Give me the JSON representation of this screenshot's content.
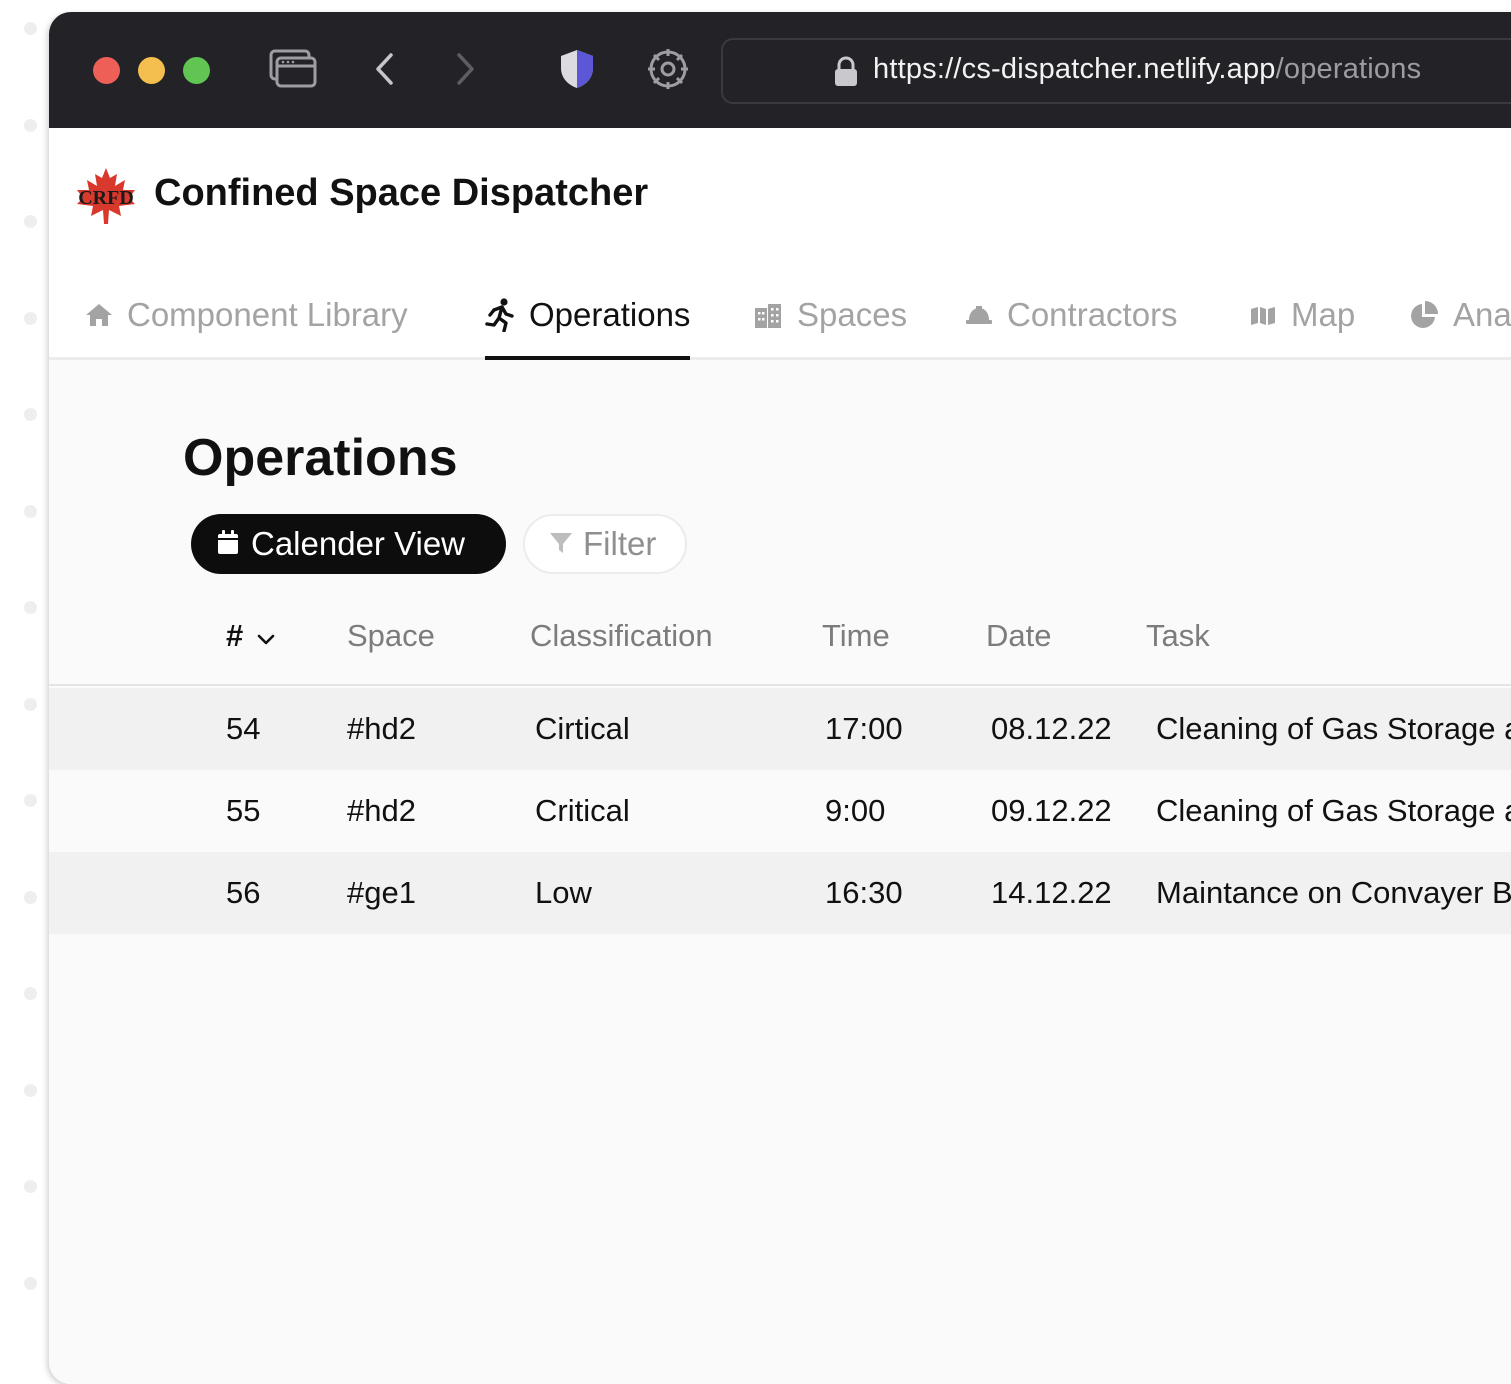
{
  "browser": {
    "url_host": "https://cs-dispatcher.netlify.app",
    "url_path": "/operations",
    "icons": [
      "tabs-icon",
      "back-icon",
      "forward-icon",
      "shield-icon",
      "settings-icon",
      "lock-icon"
    ]
  },
  "app": {
    "logo_text": "CRFD",
    "title": "Confined Space Dispatcher"
  },
  "nav": {
    "items": [
      {
        "label": "Component Library",
        "icon": "home-icon",
        "active": false
      },
      {
        "label": "Operations",
        "icon": "running-person-icon",
        "active": true
      },
      {
        "label": "Spaces",
        "icon": "buildings-icon",
        "active": false
      },
      {
        "label": "Contractors",
        "icon": "hard-hat-icon",
        "active": false
      },
      {
        "label": "Map",
        "icon": "map-icon",
        "active": false
      },
      {
        "label": "Ana",
        "icon": "pie-chart-icon",
        "active": false
      }
    ]
  },
  "main": {
    "heading": "Operations",
    "calendar_button": "Calender View",
    "filter_button": "Filter"
  },
  "table": {
    "columns": [
      "#",
      "Space",
      "Classification",
      "Time",
      "Date",
      "Task"
    ],
    "rows": [
      {
        "num": "54",
        "space": "#hd2",
        "classification": "Cirtical",
        "time": "17:00",
        "date": "08.12.22",
        "task": "Cleaning of Gas Storage ar"
      },
      {
        "num": "55",
        "space": "#hd2",
        "classification": "Critical",
        "time": "9:00",
        "date": "09.12.22",
        "task": "Cleaning of Gas Storage ar"
      },
      {
        "num": "56",
        "space": "#ge1",
        "classification": "Low",
        "time": "16:30",
        "date": "14.12.22",
        "task": "Maintance on Convayer Be"
      }
    ]
  },
  "colors": {
    "titlebar": "#232226",
    "accent": "#0d0d0d",
    "logo_red": "#d9382c"
  }
}
